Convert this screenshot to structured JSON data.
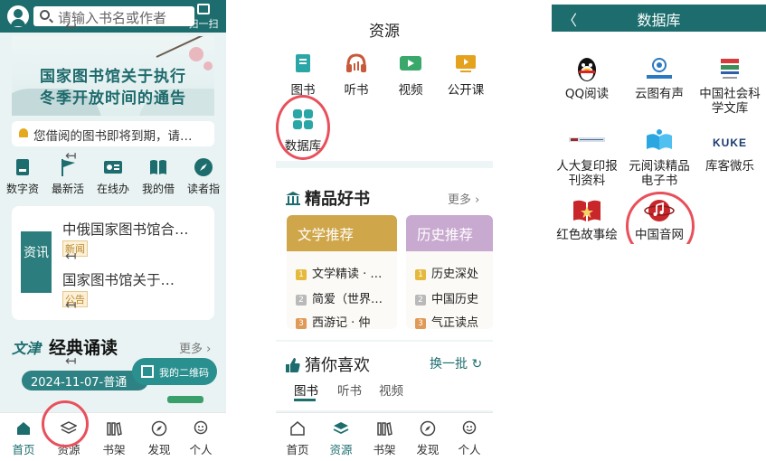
{
  "phone1": {
    "search_placeholder": "请输入书名或作者",
    "scan_label": "扫一扫",
    "banner_line1": "国家图书馆关于执行",
    "banner_line2": "冬季开放时间的通告",
    "notice_text": "您借阅的图书即将到期，请…",
    "quick_items": [
      {
        "label": "数字资",
        "icon": "digital-resource-icon"
      },
      {
        "label": "最新活",
        "icon": "flag-icon"
      },
      {
        "label": "在线办",
        "icon": "id-card-icon"
      },
      {
        "label": "我的借",
        "icon": "book-icon"
      },
      {
        "label": "读者指",
        "icon": "compass-icon"
      }
    ],
    "news_tag": "资讯",
    "news": [
      {
        "title": "中俄国家图书馆合…",
        "badge": "新闻"
      },
      {
        "title": "国家图书馆关于…",
        "badge": "公告"
      }
    ],
    "classic_logo": "文津",
    "classic_title": "经典诵读",
    "more_label": "更多",
    "date_text": "2024-11-07-普通",
    "qr_label": "我的二维码",
    "tabs": [
      {
        "label": "首页",
        "icon": "home-icon",
        "active": true
      },
      {
        "label": "资源",
        "icon": "layers-icon",
        "active": false
      },
      {
        "label": "书架",
        "icon": "bookshelf-icon",
        "active": false
      },
      {
        "label": "发现",
        "icon": "compass-icon",
        "active": false
      },
      {
        "label": "个人",
        "icon": "user-face-icon",
        "active": false
      }
    ]
  },
  "phone2": {
    "title": "资源",
    "resources": [
      {
        "label": "图书",
        "icon": "book-icon"
      },
      {
        "label": "听书",
        "icon": "headphones-icon"
      },
      {
        "label": "视频",
        "icon": "video-icon"
      },
      {
        "label": "公开课",
        "icon": "play-board-icon"
      },
      {
        "label": "数据库",
        "icon": "database-grid-icon"
      }
    ],
    "featured_title": "精品好书",
    "more_label": "更多",
    "recommend_cards": [
      {
        "title": "文学推荐",
        "rows": [
          "文学精读 · …",
          "简爱（世界…",
          "西游记 · 仲"
        ]
      },
      {
        "title": "历史推荐",
        "rows": [
          "历史深处",
          "中国历史",
          "气正读点"
        ]
      }
    ],
    "guess_title": "猜你喜欢",
    "refresh_label": "换一批",
    "sub_tabs": [
      "图书",
      "听书",
      "视频"
    ],
    "tabs": [
      {
        "label": "首页",
        "icon": "home-icon",
        "active": false
      },
      {
        "label": "资源",
        "icon": "layers-icon",
        "active": true
      },
      {
        "label": "书架",
        "icon": "bookshelf-icon",
        "active": false
      },
      {
        "label": "发现",
        "icon": "compass-icon",
        "active": false
      },
      {
        "label": "个人",
        "icon": "user-face-icon",
        "active": false
      }
    ]
  },
  "phone3": {
    "back_label": "〈",
    "title": "数据库",
    "databases": [
      {
        "label": "QQ阅读",
        "icon": "penguin-icon"
      },
      {
        "label": "云图有声",
        "icon": "cloud-audio-icon"
      },
      {
        "label": "中国社会科学文库",
        "icon": "social-science-icon"
      },
      {
        "label": "人大复印报刊资料",
        "icon": "renda-icon"
      },
      {
        "label": "元阅读精品电子书",
        "icon": "open-book-icon"
      },
      {
        "label": "库客微乐",
        "icon": "kuke-icon"
      },
      {
        "label": "红色故事绘",
        "icon": "red-book-icon"
      },
      {
        "label": "中国音网",
        "icon": "music-globe-icon"
      }
    ],
    "kuke_logo": "KUKE"
  },
  "colors": {
    "primary": "#1d6d6e",
    "highlight": "#e8505b",
    "gold": "#d0a64a",
    "purple": "#c8a9d0"
  }
}
